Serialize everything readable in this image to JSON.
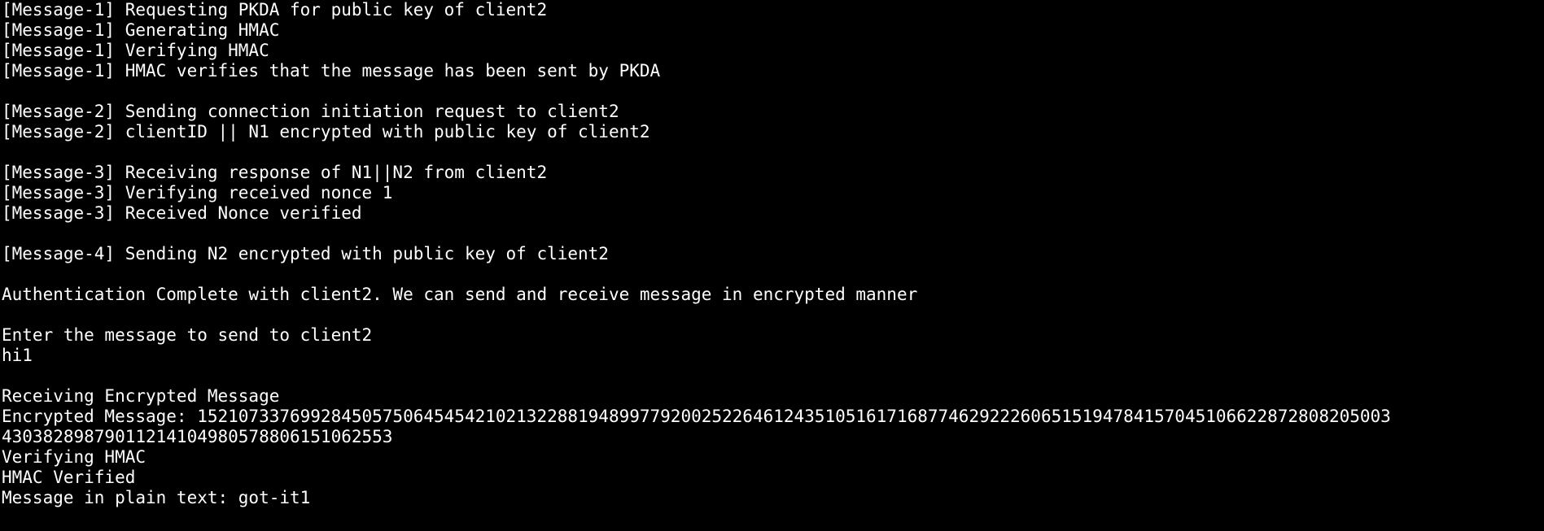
{
  "terminal": {
    "background_color": "#000000",
    "text_color": "#ffffff",
    "lines": [
      "[Message-1] Requesting PKDA for public key of client2",
      "[Message-1] Generating HMAC",
      "[Message-1] Verifying HMAC",
      "[Message-1] HMAC verifies that the message has been sent by PKDA",
      "",
      "[Message-2] Sending connection initiation request to client2",
      "[Message-2] clientID || N1 encrypted with public key of client2",
      "",
      "[Message-3] Receiving response of N1||N2 from client2",
      "[Message-3] Verifying received nonce 1",
      "[Message-3] Received Nonce verified",
      "",
      "[Message-4] Sending N2 encrypted with public key of client2",
      "",
      "Authentication Complete with client2. We can send and receive message in encrypted manner",
      "",
      "Enter the message to send to client2",
      "hi1",
      "",
      "Receiving Encrypted Message",
      "Encrypted Message: 1521073376992845057506454542102132288194899779200252264612435105161716877462922260651519478415704510662287280820500З",
      "4303828987901121410498057880615106255З",
      "Verifying HMAC",
      "HMAC Verified",
      "Message in plain text: got-it1"
    ]
  }
}
